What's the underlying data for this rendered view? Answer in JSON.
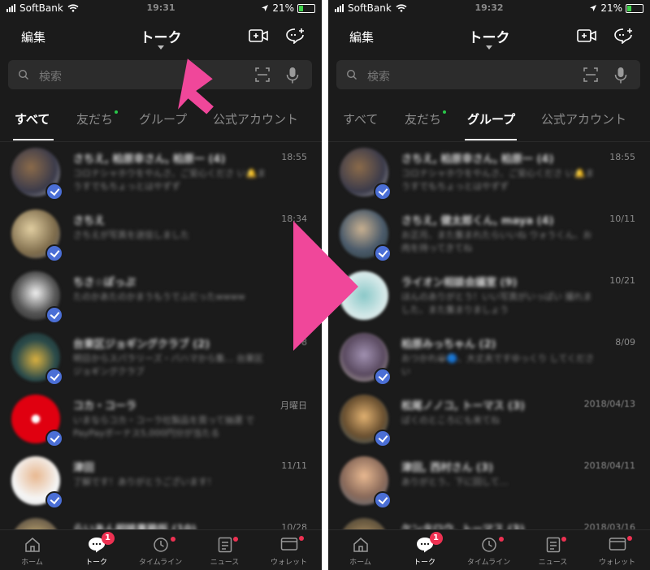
{
  "colors": {
    "accent_pink": "#f0479a",
    "badge_red": "#ee3152",
    "new_dot_green": "#29c94a",
    "verified_blue": "#4b6fd6",
    "background": "#1b1b1b"
  },
  "left": {
    "status": {
      "carrier": "SoftBank",
      "time": "19:31",
      "battery": "21%"
    },
    "header": {
      "edit": "編集",
      "title": "トーク"
    },
    "search": {
      "placeholder": "検索"
    },
    "tabs": [
      "すべて",
      "友だち",
      "グループ",
      "公式アカウント"
    ],
    "active_tab": "すべて",
    "rows": [
      {
        "name": "さちえ, 柏原幸さん, 柏原一",
        "count": "(4)",
        "time": "18:55",
        "msg": "コロナシャホウをやんさ、ご安心くださ い🔔まうすでもちょっとはやずず",
        "avatar": "group-photo"
      },
      {
        "name": "さちえ",
        "count": "",
        "time": "18:34",
        "msg": "さちえが写真を送信しました",
        "avatar": "friend-photo"
      },
      {
        "name": "ちさ☆ぽっぷ",
        "count": "",
        "time": "15",
        "msg": "たのかあたのかまうもうでふだったwwww",
        "avatar": "friend-photo"
      },
      {
        "name": "台東区ジョギングクラブ",
        "count": "(2)",
        "time": "8",
        "msg": "明日からスパラリーズ・バハマから集… 台東区ジョギングクラブ",
        "avatar": "group-photo"
      },
      {
        "name": "コカ・コーラ",
        "count": "",
        "time": "月曜日",
        "msg": "いまならコカ・コーラ社製品を買って抽選 でPayPayボーナス5,000円分が当たる",
        "avatar": "official-logo"
      },
      {
        "name": "津田",
        "count": "",
        "time": "11/11",
        "msg": "了解です！ありがとうございます！",
        "avatar": "friend-photo"
      },
      {
        "name": "らいあん相談事務所",
        "count": "(10)",
        "time": "10/28",
        "msg": "",
        "avatar": "group-photo"
      }
    ]
  },
  "right": {
    "status": {
      "carrier": "SoftBank",
      "time": "19:32",
      "battery": "21%"
    },
    "header": {
      "edit": "編集",
      "title": "トーク"
    },
    "search": {
      "placeholder": "検索"
    },
    "tabs": [
      "すべて",
      "友だち",
      "グループ",
      "公式アカウント"
    ],
    "active_tab": "グループ",
    "rows": [
      {
        "name": "さちえ, 柏原幸さん, 柏原一",
        "count": "(4)",
        "time": "18:55",
        "msg": "コロナシャホウをやんさ、ご安心くださ い🔔まうすでもちょっとはやずず",
        "avatar": "group-photo"
      },
      {
        "name": "さちえ, 健太郎くん, maya",
        "count": "(4)",
        "time": "10/11",
        "msg": "お正月、また集まれたらいいね ウォうくん、お肉を持ってきてね",
        "avatar": "group-photo"
      },
      {
        "name": "ライオン相談会議室",
        "count": "(9)",
        "time": "10/21",
        "msg": "ほんのありがとう！いい写真がいっぱい 撮れました、また集まりましょう",
        "avatar": "group-photo"
      },
      {
        "name": "柏原みっちゃん",
        "count": "(2)",
        "time": "8/09",
        "msg": "おつかれ😀🔵、大丈夫ですゆっくり してください",
        "avatar": "group-photo"
      },
      {
        "name": "松尾ノノコ, トーマス",
        "count": "(3)",
        "time": "2018/04/13",
        "msg": "ばくのところにも来てね",
        "avatar": "group-photo"
      },
      {
        "name": "津田, 西村さん",
        "count": "(3)",
        "time": "2018/04/11",
        "msg": "ありがとう、下に回して…",
        "avatar": "group-photo"
      },
      {
        "name": "ケンタロウ, トーマス",
        "count": "(3)",
        "time": "2018/03/16",
        "msg": "",
        "avatar": "group-photo"
      }
    ]
  },
  "bottom_nav": [
    {
      "label": "ホーム",
      "icon": "home-icon"
    },
    {
      "label": "トーク",
      "icon": "talk-icon",
      "badge": "1"
    },
    {
      "label": "タイムライン",
      "icon": "timeline-icon"
    },
    {
      "label": "ニュース",
      "icon": "news-icon"
    },
    {
      "label": "ウォレット",
      "icon": "wallet-icon"
    }
  ]
}
